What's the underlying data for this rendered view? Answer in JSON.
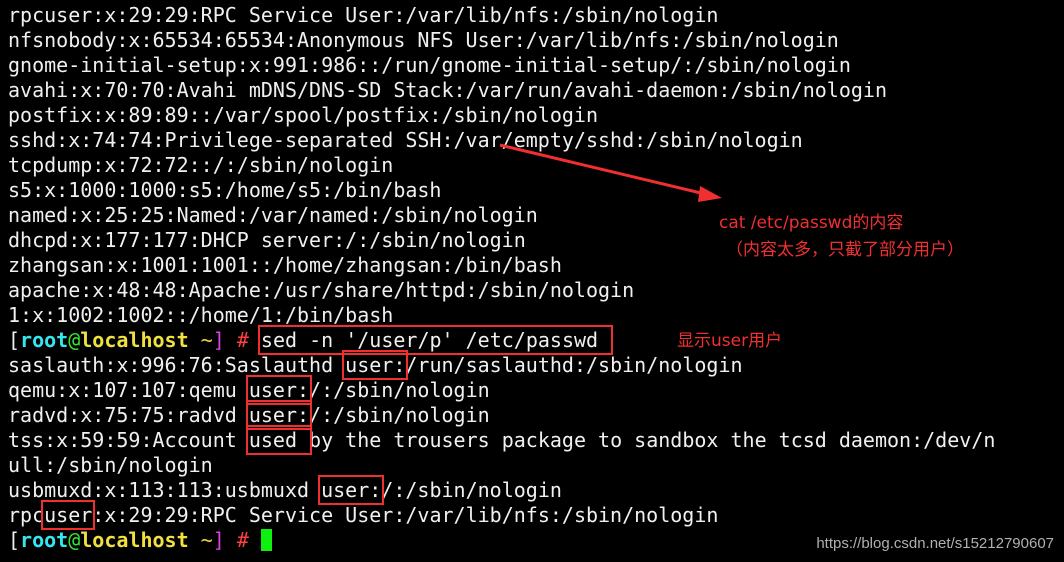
{
  "terminal": {
    "prompt": {
      "open": "[",
      "user": "root",
      "at": "@",
      "host": "localhost",
      "space": " ",
      "tilde": "~",
      "close": "]",
      "hash": " #"
    },
    "lines": [
      [
        {
          "t": "rpcuser:x:29:29:RPC Service User:/var/lib/nfs:/sbin/nologin"
        }
      ],
      [
        {
          "t": "nfsnobody:x:65534:65534:Anonymous NFS User:/var/lib/nfs:/sbin/nologin"
        }
      ],
      [
        {
          "t": "gnome-initial-setup:x:991:986::/run/gnome-initial-setup/:/sbin/nologin"
        }
      ],
      [
        {
          "t": "avahi:x:70:70:Avahi mDNS/DNS-SD Stack:/var/run/avahi-daemon:/sbin/nologin"
        }
      ],
      [
        {
          "t": "postfix:x:89:89::/var/spool/postfix:/sbin/nologin"
        }
      ],
      [
        {
          "t": "sshd:x:74:74:Privilege-separated SSH:/var/empty/sshd:/sbin/nologin"
        }
      ],
      [
        {
          "t": "tcpdump:x:72:72::/:/sbin/nologin"
        }
      ],
      [
        {
          "t": "s5:x:1000:1000:s5:/home/s5:/bin/bash"
        }
      ],
      [
        {
          "t": "named:x:25:25:Named:/var/named:/sbin/nologin"
        }
      ],
      [
        {
          "t": "dhcpd:x:177:177:DHCP server:/:/sbin/nologin"
        }
      ],
      [
        {
          "t": "zhangsan:x:1001:1001::/home/zhangsan:/bin/bash"
        }
      ],
      [
        {
          "t": "apache:x:48:48:Apache:/usr/share/httpd:/sbin/nologin"
        }
      ],
      [
        {
          "t": "1:x:1002:1002::/home/1:/bin/bash"
        }
      ],
      [
        {
          "prompt": true
        },
        {
          "t": " "
        },
        {
          "t": "sed -n '/user/p' /etc/passwd ",
          "box": true
        }
      ],
      [
        {
          "t": "saslauth:x:996:76:Saslauthd "
        },
        {
          "t": "user:",
          "box": true
        },
        {
          "t": "/run/saslauthd:/sbin/nologin"
        }
      ],
      [
        {
          "t": "qemu:x:107:107:qemu "
        },
        {
          "t": "user:",
          "box": true
        },
        {
          "t": "/:/sbin/nologin"
        }
      ],
      [
        {
          "t": "radvd:x:75:75:radvd "
        },
        {
          "t": "user:",
          "box": true
        },
        {
          "t": "/:/sbin/nologin"
        }
      ],
      [
        {
          "t": "tss:x:59:59:Account "
        },
        {
          "t": "used ",
          "box": true
        },
        {
          "t": "by the trousers package to sandbox the tcsd daemon:/dev/n"
        }
      ],
      [
        {
          "t": "ull:/sbin/nologin"
        }
      ],
      [
        {
          "t": "usbmuxd:x:113:113:usbmuxd "
        },
        {
          "t": "user:",
          "box": true
        },
        {
          "t": "/:/sbin/nologin"
        }
      ],
      [
        {
          "t": "rpc"
        },
        {
          "t": "user",
          "box": true
        },
        {
          "t": ":x:29:29:RPC Service User:/var/lib/nfs:/sbin/nologin"
        }
      ],
      [
        {
          "prompt": true
        },
        {
          "t": " "
        },
        {
          "cursor": true
        }
      ]
    ]
  },
  "annotations": {
    "note1_line1": "cat /etc/passwd的内容",
    "note1_line2": "（内容太多，只截了部分用户）",
    "note2": "显示user用户",
    "color": "#f03030"
  },
  "watermark": "https://blog.csdn.net/s15212790607"
}
